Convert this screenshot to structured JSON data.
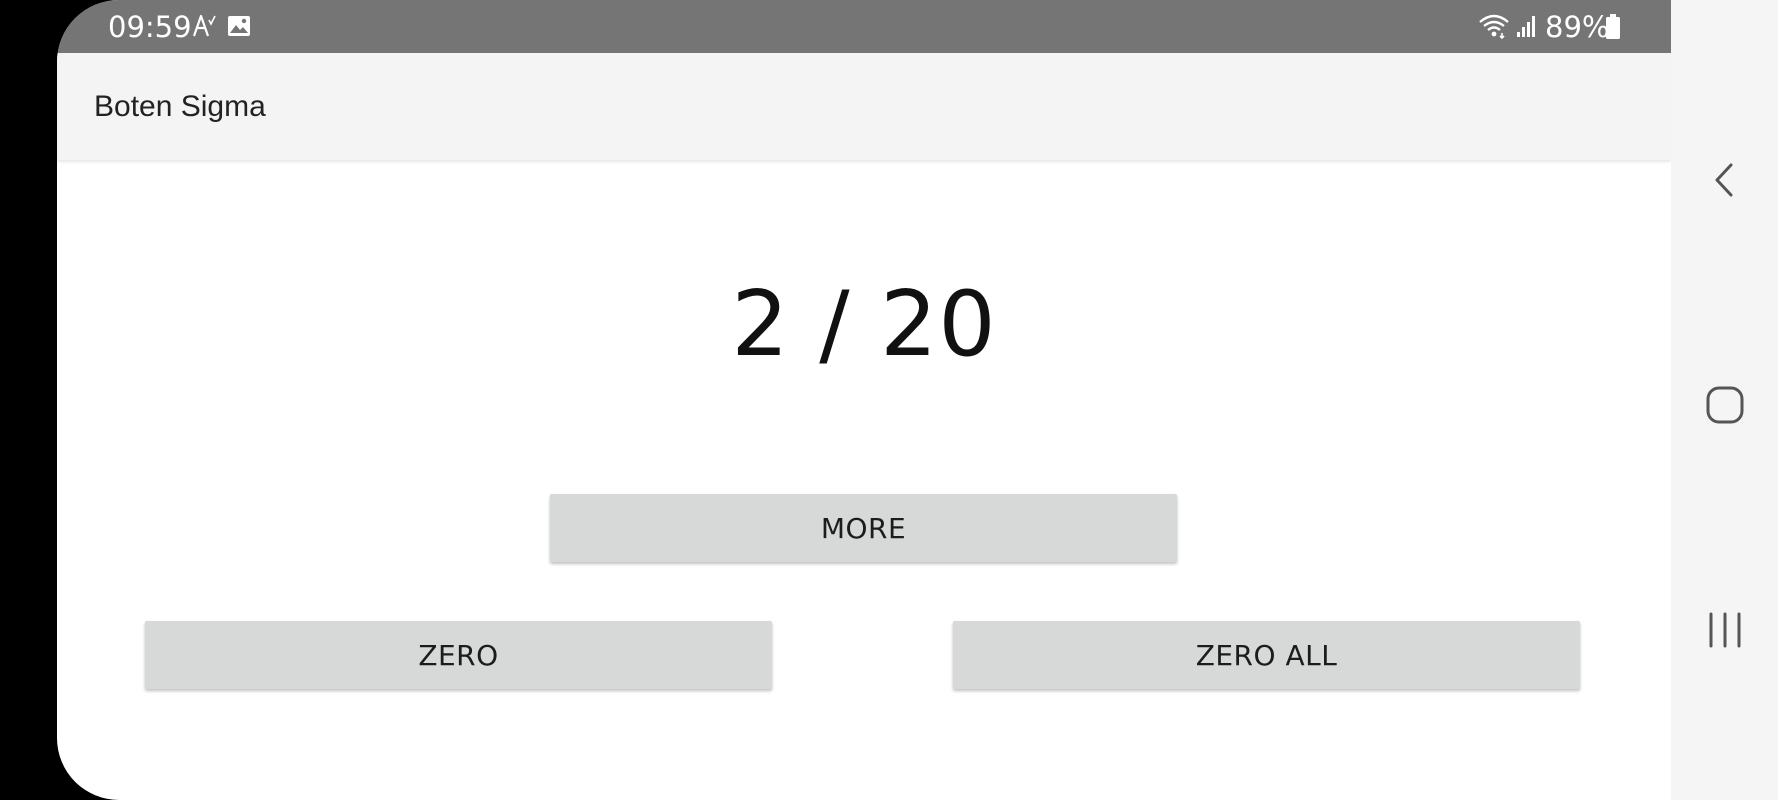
{
  "status_bar": {
    "time": "09:59",
    "battery_percent": "89%",
    "icons": [
      "a-icon",
      "image-icon",
      "wifi-icon",
      "signal-icon",
      "battery-icon"
    ]
  },
  "app_bar": {
    "title": "Boten Sigma"
  },
  "main": {
    "counter": "2 / 20",
    "more_label": "MORE",
    "zero_label": "ZERO",
    "zero_all_label": "ZERO ALL"
  },
  "nav_bar": {
    "icons": [
      "back-icon",
      "home-icon",
      "recents-icon"
    ]
  },
  "colors": {
    "status_bar_bg": "#757575",
    "app_bar_bg": "#f4f4f4",
    "button_bg": "#d7d8d8",
    "nav_bar_bg": "#f5f5f5"
  }
}
